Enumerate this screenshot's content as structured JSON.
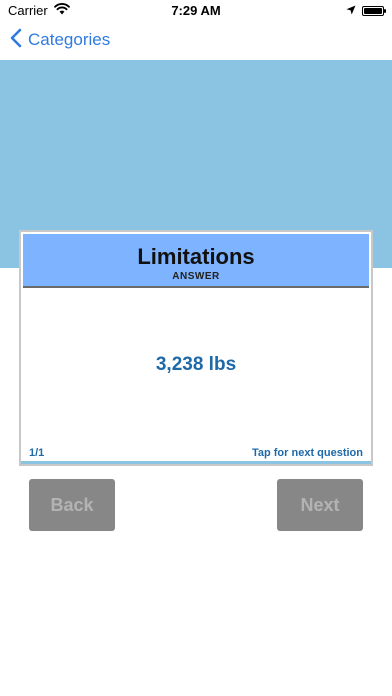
{
  "status_bar": {
    "carrier": "Carrier",
    "time": "7:29 AM",
    "icons": [
      "wifi-icon",
      "location-arrow-icon",
      "battery-icon"
    ]
  },
  "nav": {
    "back_label": "Categories",
    "back_icon": "chevron-left-icon"
  },
  "card": {
    "title": "Limitations",
    "subtitle": "ANSWER",
    "answer": "3,238 lbs",
    "counter": "1/1",
    "hint": "Tap for next question"
  },
  "buttons": {
    "back_label": "Back",
    "next_label": "Next"
  },
  "colors": {
    "accent": "#2f7be0",
    "banner": "#8bc4e3",
    "card_header": "#7db3ff",
    "answer_text": "#1e69a8",
    "button_bg": "#878787",
    "button_text": "#b3b3b3"
  }
}
